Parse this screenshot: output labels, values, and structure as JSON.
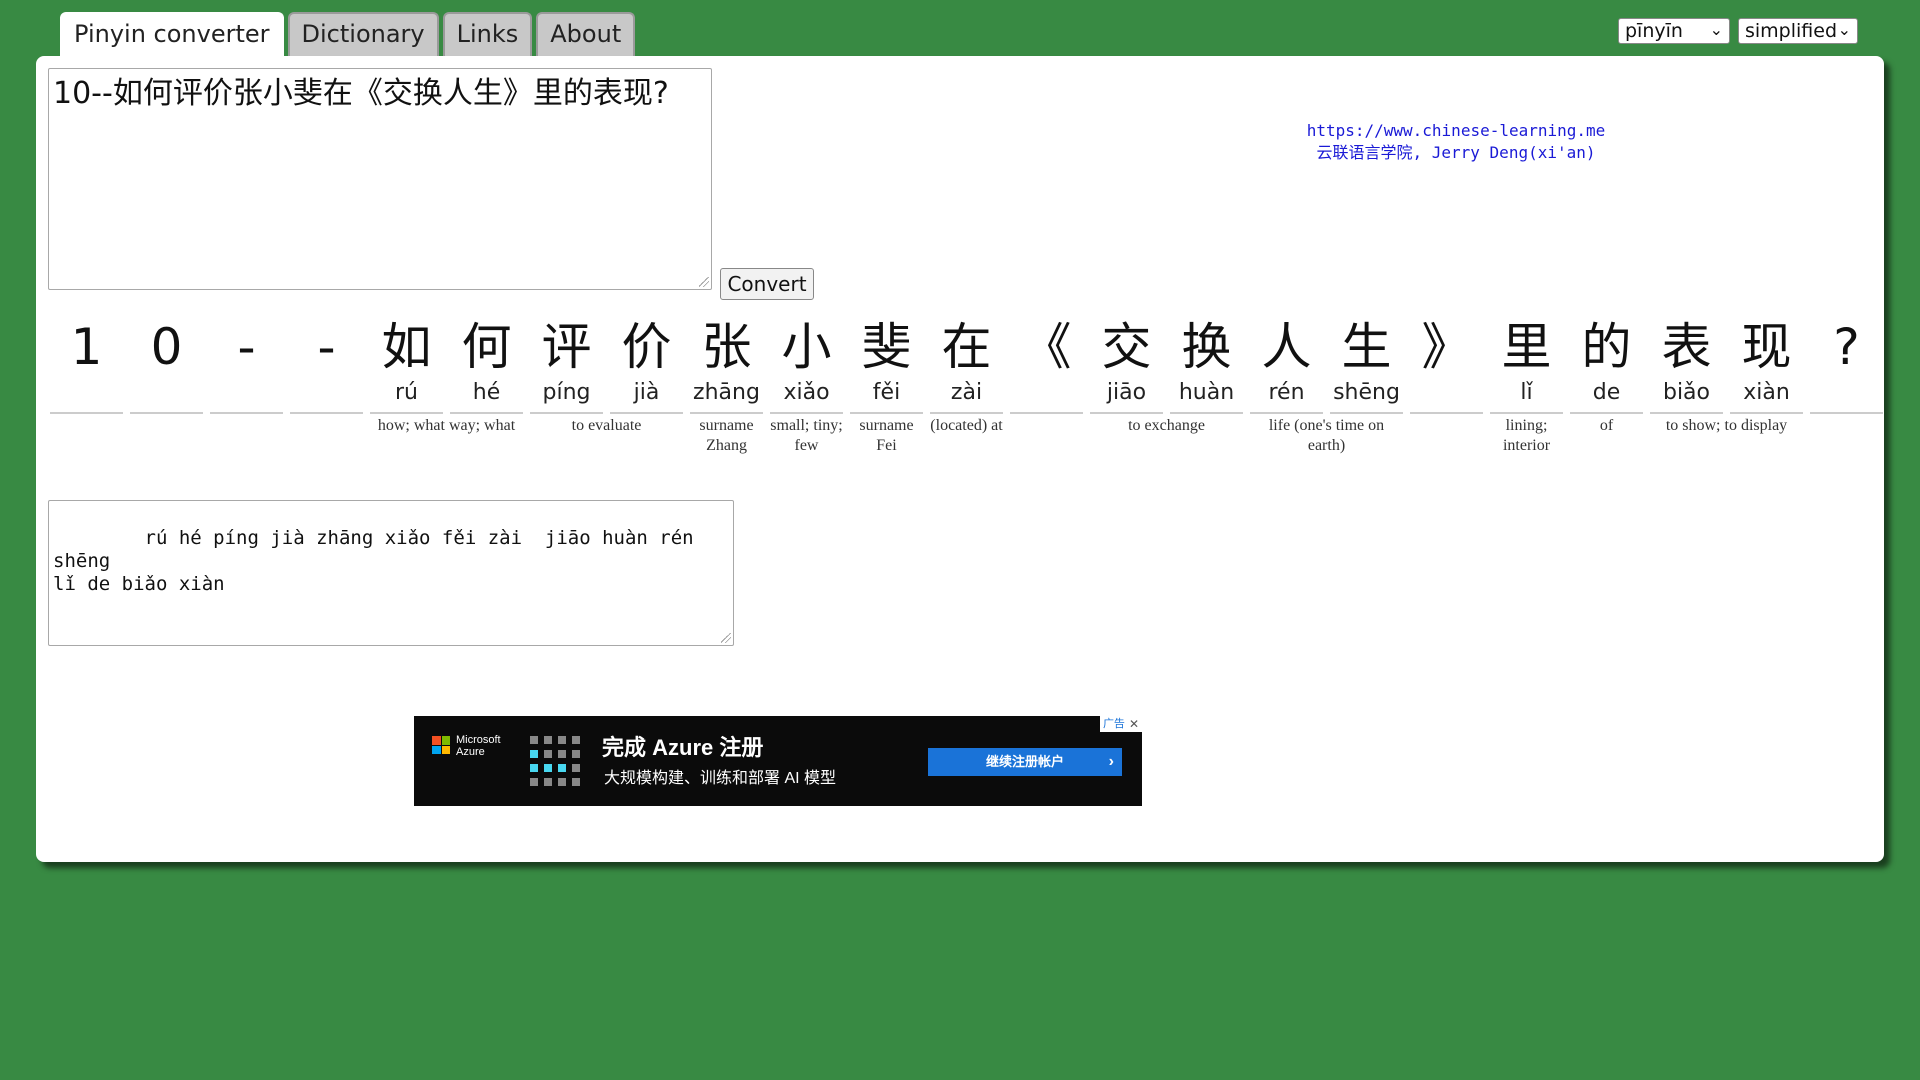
{
  "tabs": [
    {
      "label": "Pinyin converter",
      "active": true
    },
    {
      "label": "Dictionary",
      "active": false
    },
    {
      "label": "Links",
      "active": false
    },
    {
      "label": "About",
      "active": false
    }
  ],
  "selects": {
    "mode": "pīnyīn",
    "script": "simplified"
  },
  "input": {
    "value": "10--如何评价张小斐在《交换人生》里的表现?"
  },
  "convert_label": "Convert",
  "credit": {
    "url": "https://www.chinese-learning.me",
    "byline": "云联语言学院, Jerry Deng(xi'an)"
  },
  "characters": [
    {
      "ch": "1",
      "py": ""
    },
    {
      "ch": "0",
      "py": ""
    },
    {
      "ch": "-",
      "py": ""
    },
    {
      "ch": "-",
      "py": ""
    },
    {
      "ch": "如",
      "py": "rú"
    },
    {
      "ch": "何",
      "py": "hé"
    },
    {
      "ch": "评",
      "py": "píng"
    },
    {
      "ch": "价",
      "py": "jià"
    },
    {
      "ch": "张",
      "py": "zhāng"
    },
    {
      "ch": "小",
      "py": "xiǎo"
    },
    {
      "ch": "斐",
      "py": "fěi"
    },
    {
      "ch": "在",
      "py": "zài"
    },
    {
      "ch": "《",
      "py": ""
    },
    {
      "ch": "交",
      "py": "jiāo"
    },
    {
      "ch": "换",
      "py": "huàn"
    },
    {
      "ch": "人",
      "py": "rén"
    },
    {
      "ch": "生",
      "py": "shēng"
    },
    {
      "ch": "》",
      "py": ""
    },
    {
      "ch": "里",
      "py": "lǐ"
    },
    {
      "ch": "的",
      "py": "de"
    },
    {
      "ch": "表",
      "py": "biǎo"
    },
    {
      "ch": "现",
      "py": "xiàn"
    },
    {
      "ch": "?",
      "py": ""
    }
  ],
  "definitions": [
    {
      "text": "how; what way; what",
      "start": 4,
      "span": 2
    },
    {
      "text": "to evaluate",
      "start": 6,
      "span": 2
    },
    {
      "text": "surname Zhang",
      "start": 8,
      "span": 1
    },
    {
      "text": "small; tiny; few",
      "start": 9,
      "span": 1
    },
    {
      "text": "surname Fei",
      "start": 10,
      "span": 1
    },
    {
      "text": "(located) at",
      "start": 11,
      "span": 1
    },
    {
      "text": "to exchange",
      "start": 13,
      "span": 2
    },
    {
      "text": "life (one's time on earth)",
      "start": 15,
      "span": 2
    },
    {
      "text": "lining; interior",
      "start": 18,
      "span": 1
    },
    {
      "text": "of",
      "start": 19,
      "span": 1
    },
    {
      "text": "to show; to display",
      "start": 20,
      "span": 2
    }
  ],
  "output": {
    "value": "    rú hé píng jià zhāng xiǎo fěi zài  jiāo huàn rén shēng \nlǐ de biǎo xiàn"
  },
  "ad": {
    "brand": "Microsoft Azure",
    "title": "完成 Azure 注册",
    "subtitle": "大规模构建、训练和部署 AI 模型",
    "cta": "继续注册帐户",
    "mark": "广告",
    "accent": "#1a73d8"
  },
  "colors": {
    "background": "#388a43",
    "panel": "#ffffff",
    "link": "#1a1ad6"
  }
}
